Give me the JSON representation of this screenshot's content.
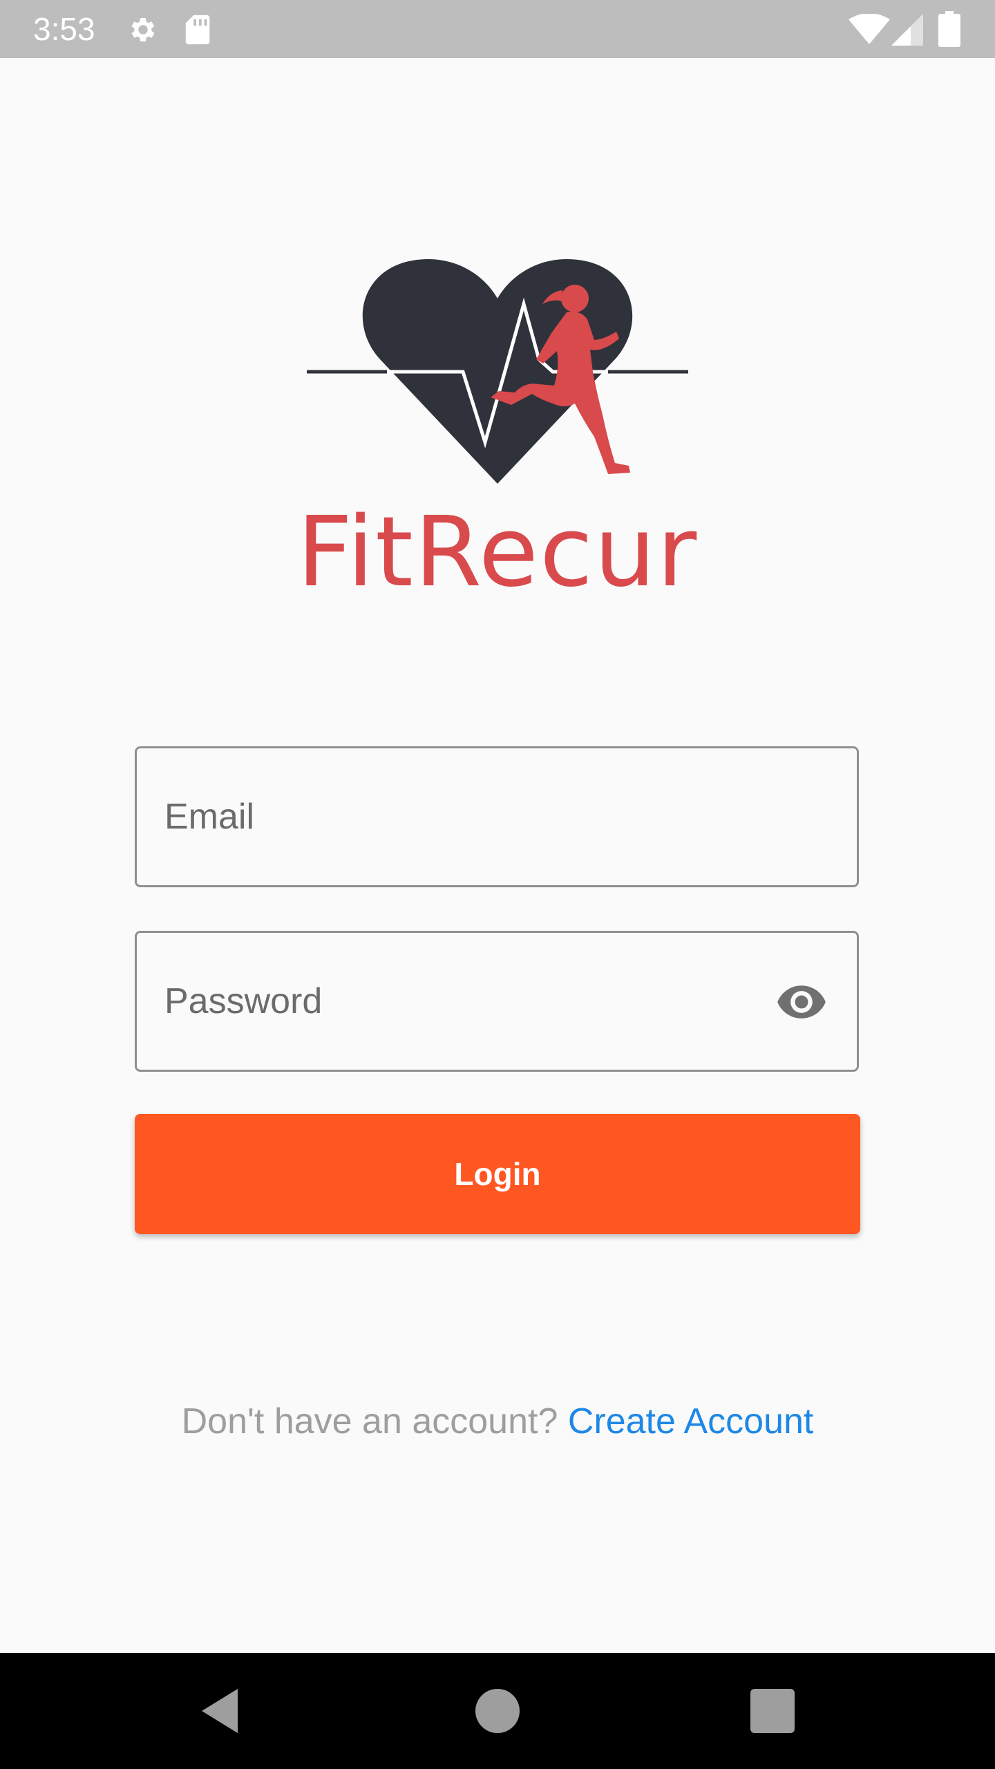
{
  "status_bar": {
    "time": "3:53",
    "icons": [
      "gear-icon",
      "sd-card-icon",
      "wifi-icon",
      "cell-signal-icon",
      "battery-icon"
    ]
  },
  "brand": {
    "name": "FitRecur",
    "logo": "heart-with-runner-logo",
    "colors": {
      "heart": "#30323b",
      "runner": "#d94a4d",
      "wordmark": "#d94a4d"
    }
  },
  "form": {
    "email_placeholder": "Email",
    "password_placeholder": "Password",
    "password_toggle_icon": "eye-icon",
    "login_label": "Login",
    "login_color": "#ff5722"
  },
  "footer": {
    "prompt": "Don't have an account?",
    "link": "Create Account",
    "link_color": "#1e88e5"
  },
  "nav_bar": {
    "buttons": [
      "back-icon",
      "home-icon",
      "recents-icon"
    ]
  }
}
